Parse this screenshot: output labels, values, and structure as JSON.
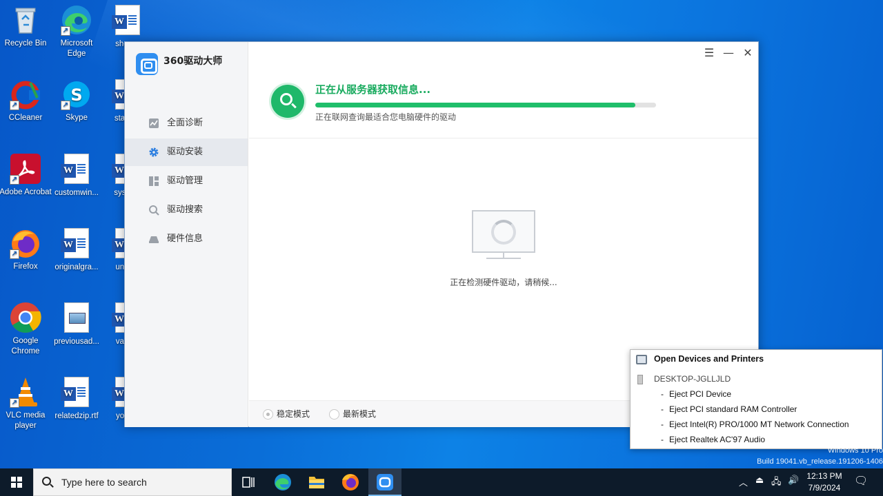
{
  "desktop": {
    "icons": [
      {
        "label": "Recycle Bin"
      },
      {
        "label": "Microsoft Edge"
      },
      {
        "label": "show..."
      },
      {
        "label": "CCleaner"
      },
      {
        "label": "Skype"
      },
      {
        "label": "starte..."
      },
      {
        "label": "Adobe Acrobat"
      },
      {
        "label": "customwin..."
      },
      {
        "label": "syster..."
      },
      {
        "label": "Firefox"
      },
      {
        "label": "originalgra..."
      },
      {
        "label": "unde..."
      },
      {
        "label": "Google Chrome"
      },
      {
        "label": "previousad..."
      },
      {
        "label": "vario..."
      },
      {
        "label": "VLC media player"
      },
      {
        "label": "relatedzip.rtf"
      },
      {
        "label": "youti..."
      }
    ]
  },
  "app": {
    "title": "360驱动大师",
    "nav": [
      {
        "label": "全面诊断",
        "icon": "chart-icon"
      },
      {
        "label": "驱动安装",
        "icon": "gear-icon"
      },
      {
        "label": "驱动管理",
        "icon": "grid-icon"
      },
      {
        "label": "驱动搜索",
        "icon": "search-icon"
      },
      {
        "label": "硬件信息",
        "icon": "disk-icon"
      }
    ],
    "active_nav": "驱动安装",
    "status": {
      "title": "正在从服务器获取信息...",
      "subtitle": "正在联网查询最适合您电脑硬件的驱动",
      "progress": 0.94
    },
    "detecting_text": "正在检测硬件驱动，请稍候...",
    "modes": [
      {
        "label": "稳定模式",
        "selected": true
      },
      {
        "label": "最新模式",
        "selected": false
      }
    ],
    "colors": {
      "accent_green": "#1fbe6a",
      "accent_blue": "#2d7fe0"
    }
  },
  "popup": {
    "header": "Open Devices and Printers",
    "device": "DESKTOP-JGLLJLD",
    "items": [
      "Eject PCI Device",
      "Eject PCI standard RAM Controller",
      "Eject Intel(R) PRO/1000 MT Network Connection",
      "Eject Realtek AC'97 Audio"
    ]
  },
  "watermark": {
    "line1": "Windows 10 Pro",
    "line2": "Build 19041.vb_release.191206-1406"
  },
  "taskbar": {
    "search_placeholder": "Type here to search",
    "time": "12:13 PM",
    "date": "7/9/2024"
  }
}
